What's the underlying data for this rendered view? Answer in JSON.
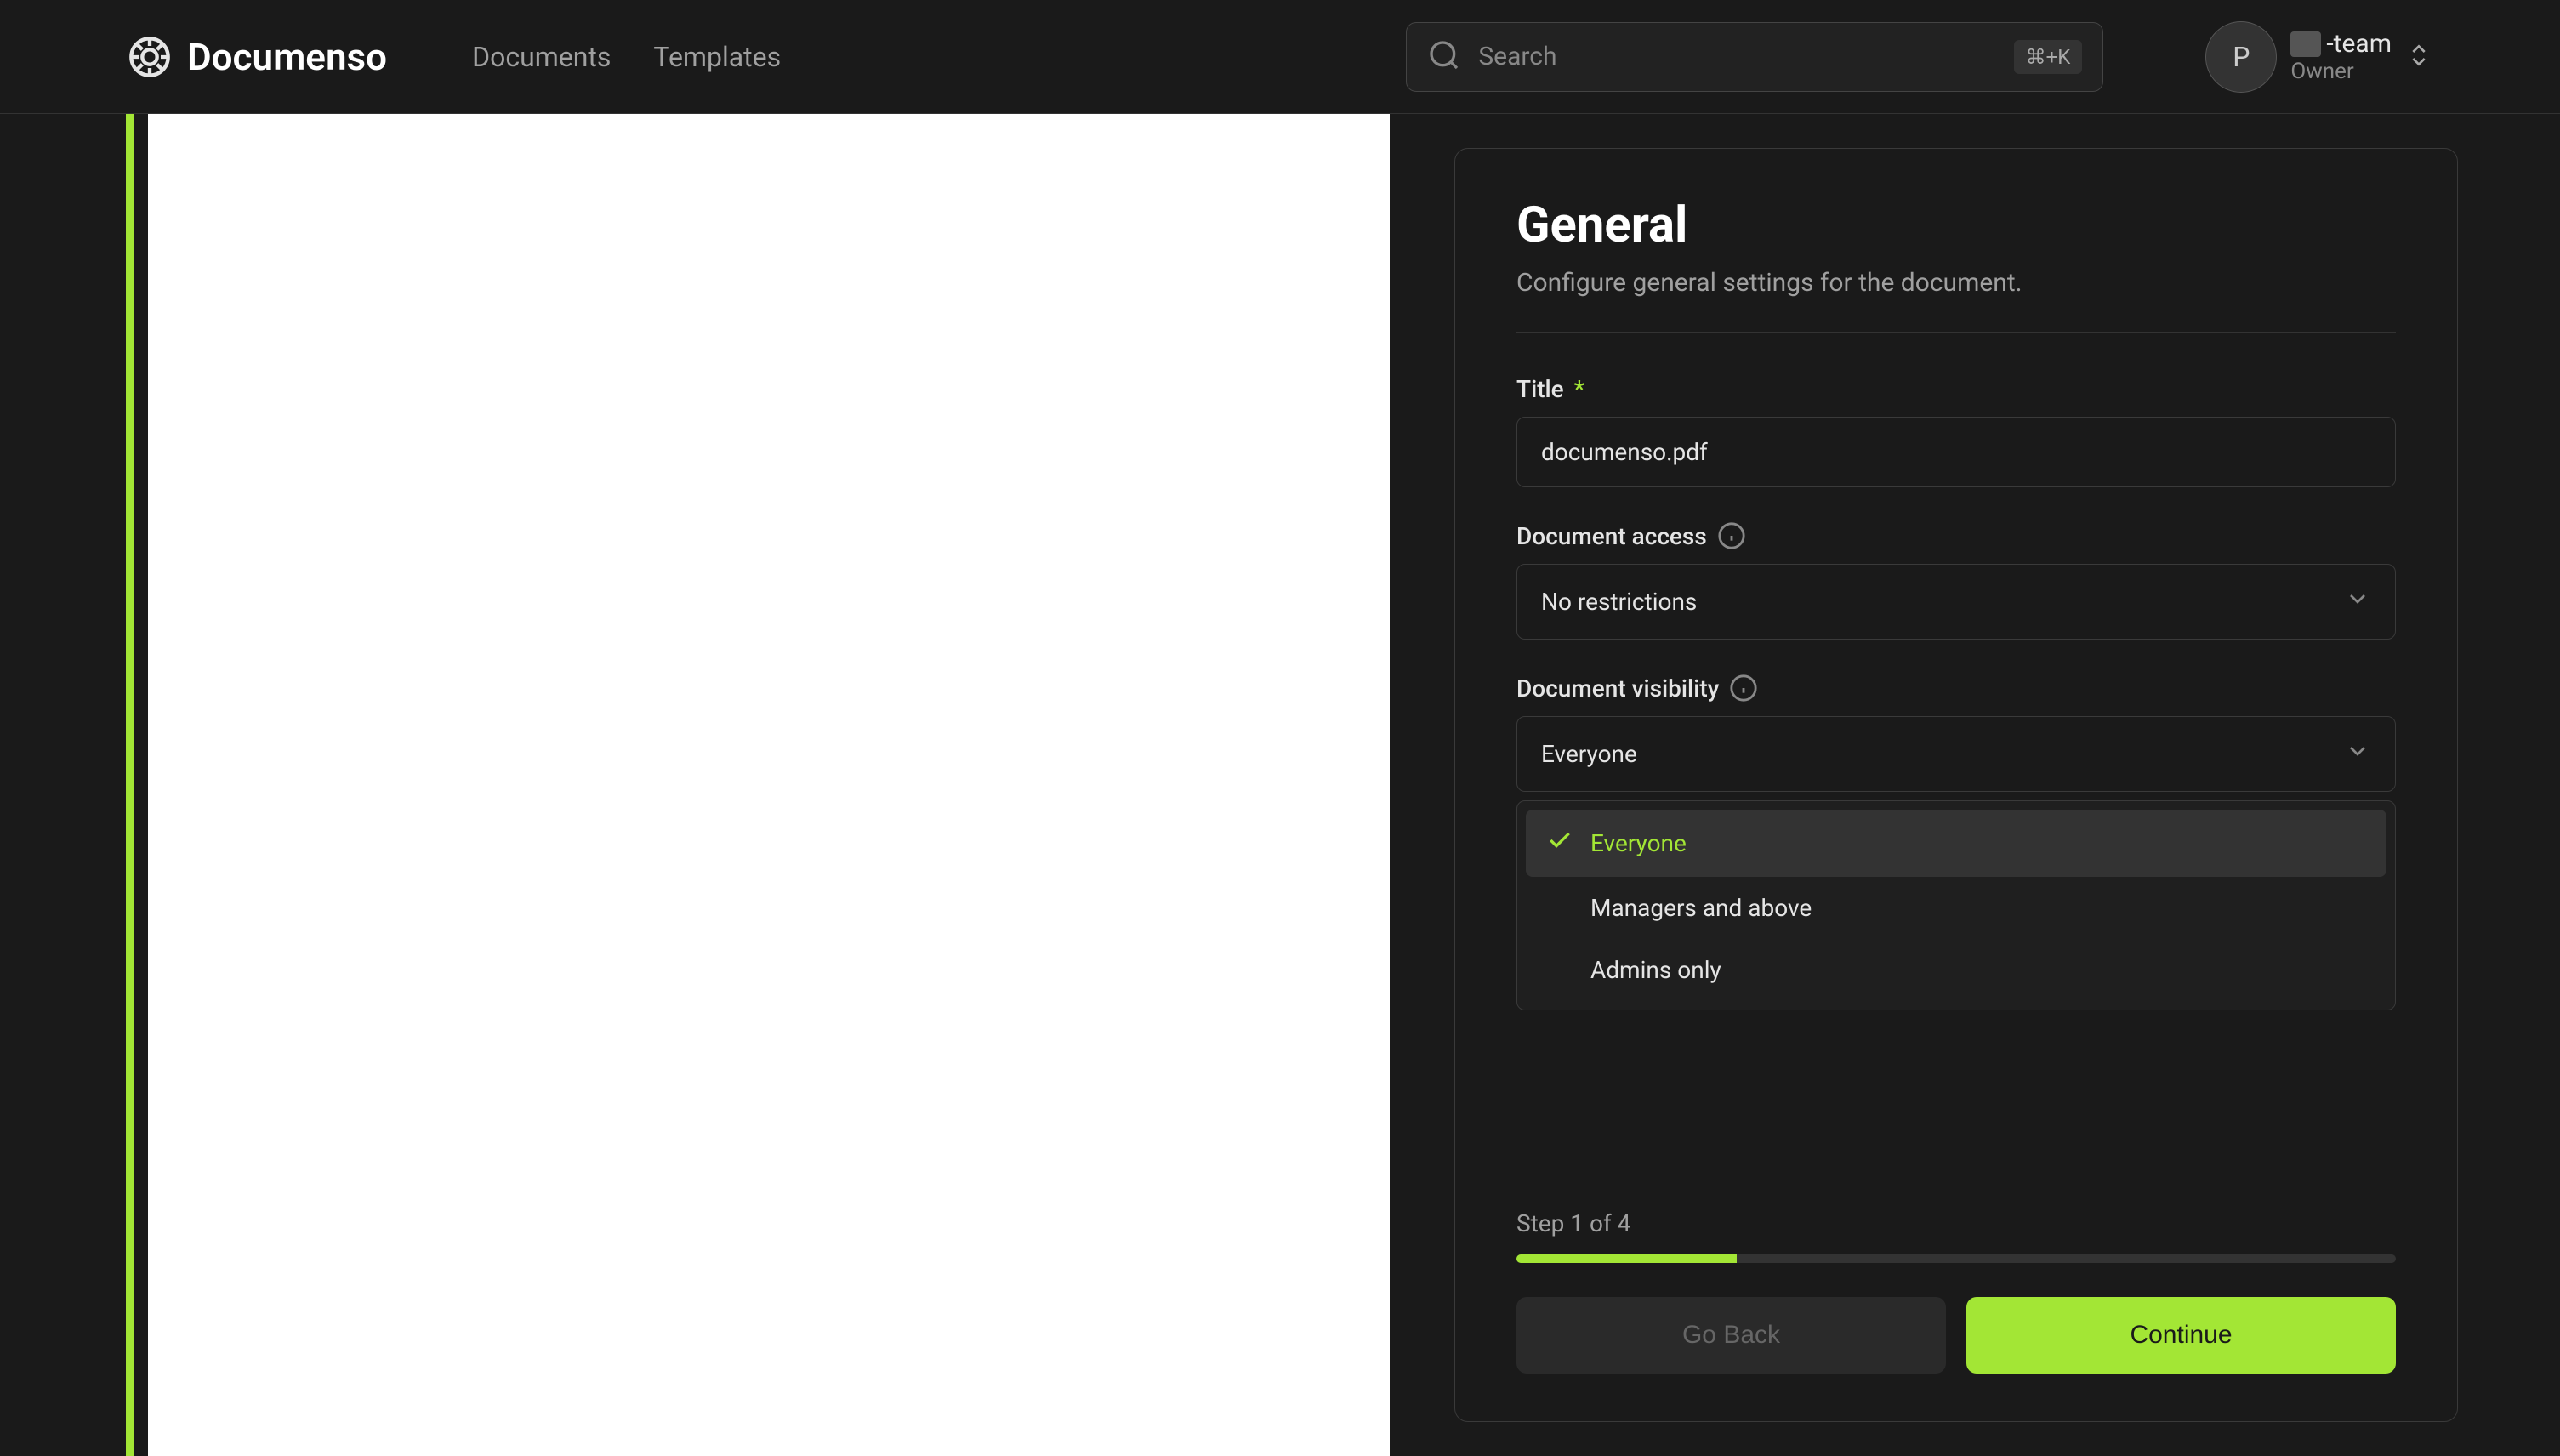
{
  "header": {
    "logo_text": "Documenso",
    "nav": {
      "documents": "Documents",
      "templates": "Templates"
    },
    "search": {
      "placeholder": "Search",
      "shortcut": "⌘+K"
    },
    "user": {
      "avatar_initial": "P",
      "team_suffix": "-team",
      "role": "Owner"
    }
  },
  "panel": {
    "title": "General",
    "subtitle": "Configure general settings for the document.",
    "fields": {
      "title": {
        "label": "Title",
        "required": "*",
        "value": "documenso.pdf"
      },
      "access": {
        "label": "Document access",
        "value": "No restrictions"
      },
      "visibility": {
        "label": "Document visibility",
        "value": "Everyone",
        "options": {
          "everyone": "Everyone",
          "managers": "Managers and above",
          "admins": "Admins only"
        }
      }
    },
    "step": {
      "text": "Step 1 of 4"
    },
    "buttons": {
      "back": "Go Back",
      "continue": "Continue"
    }
  }
}
